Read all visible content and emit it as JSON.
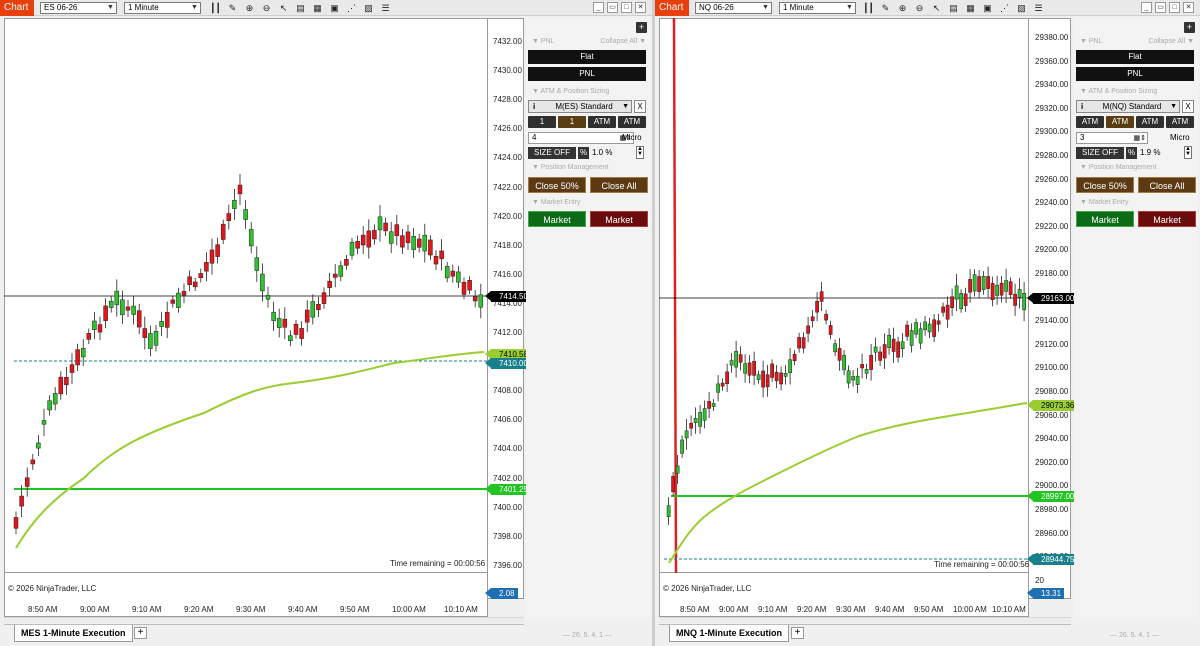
{
  "left": {
    "chart_button": "Chart",
    "instrument": "ES 06-26",
    "interval": "1 Minute",
    "copyright": "© 2026 NinjaTrader, LLC",
    "time_remaining": "Time remaining = 00:00:56",
    "tab_label": "MES 1-Minute Execution",
    "version": "— 26. 5. 4. 1 —",
    "price_labels": {
      "last": "7414.50",
      "vwap": "7410.58",
      "line_teal": "7410.00",
      "line_green": "7401.25",
      "bottom": "2.08"
    },
    "colors": {
      "last": "#000000",
      "vwap": "#9acd32",
      "teal": "#17808a",
      "green": "#22c422",
      "bottom": "#1f6fb3"
    },
    "y_ticks": [
      "7432.00",
      "7430.00",
      "7428.00",
      "7426.00",
      "7424.00",
      "7422.00",
      "7420.00",
      "7418.00",
      "7416.00",
      "7414.00",
      "7412.00",
      "7410.00",
      "7408.00",
      "7406.00",
      "7404.00",
      "7402.00",
      "7400.00",
      "7398.00",
      "7396.00"
    ],
    "x_ticks": [
      "8:50 AM",
      "9:00 AM",
      "9:10 AM",
      "9:20 AM",
      "9:30 AM",
      "9:40 AM",
      "9:50 AM",
      "10:00 AM",
      "10:10 AM"
    ],
    "panel": {
      "pnl_header": "▼ PNL",
      "collapse": "Collapse All ▼",
      "flat": "Flat",
      "pnl": "PNL",
      "atm_header": "▼ ATM & Position Sizing",
      "atm_template": "M(ES) Standard",
      "close_x": "X",
      "qty_buttons": [
        "1",
        "1",
        "ATM",
        "ATM"
      ],
      "qty_value": "4",
      "micro": "Micro",
      "size_off": "SIZE OFF",
      "pct_btn": "%",
      "pct_value": "1.0 %",
      "pos_header": "▼ Position Management",
      "close50": "Close 50%",
      "close_all": "Close All",
      "entry_header": "▼ Market Entry",
      "market_buy": "Market",
      "market_sell": "Market"
    }
  },
  "right": {
    "chart_button": "Chart",
    "instrument": "NQ 06-26",
    "interval": "1 Minute",
    "copyright": "© 2026 NinjaTrader, LLC",
    "time_remaining": "Time remaining = 00:00:56",
    "tab_label": "MNQ 1-Minute Execution",
    "version": "— 26. 5. 4. 1 —",
    "price_labels": {
      "last": "29163.00",
      "vwap": "29073.36",
      "line_green": "28997.00",
      "line_teal": "28944.75",
      "bottom": "13.31"
    },
    "colors": {
      "last": "#000000",
      "vwap": "#9acd32",
      "teal": "#17808a",
      "green": "#22c422",
      "bottom": "#1f6fb3"
    },
    "y_ticks": [
      "29380.00",
      "29360.00",
      "29340.00",
      "29320.00",
      "29300.00",
      "29280.00",
      "29260.00",
      "29240.00",
      "29220.00",
      "29200.00",
      "29180.00",
      "29160.00",
      "29140.00",
      "29120.00",
      "29100.00",
      "29080.00",
      "29060.00",
      "29040.00",
      "29020.00",
      "29000.00",
      "28980.00",
      "28960.00",
      "28940.00",
      "20"
    ],
    "x_ticks": [
      "8:50 AM",
      "9:00 AM",
      "9:10 AM",
      "9:20 AM",
      "9:30 AM",
      "9:40 AM",
      "9:50 AM",
      "10:00 AM",
      "10:10 AM"
    ],
    "panel": {
      "pnl_header": "▼ PNL",
      "collapse": "Collapse All ▼",
      "flat": "Flat",
      "pnl": "PNL",
      "atm_header": "▼ ATM & Position Sizing",
      "atm_template": "M(NQ) Standard",
      "close_x": "X",
      "qty_buttons": [
        "ATM",
        "ATM",
        "ATM",
        "ATM"
      ],
      "qty_value": "3",
      "micro": "Micro",
      "size_off": "SIZE OFF",
      "pct_btn": "%",
      "pct_value": "1.9 %",
      "pos_header": "▼ Position Management",
      "close50": "Close 50%",
      "close_all": "Close All",
      "entry_header": "▼ Market Entry",
      "market_buy": "Market",
      "market_sell": "Market"
    }
  },
  "toolbar_icons": [
    "bar-type-icon",
    "draw-icon",
    "zoom-in-icon",
    "zoom-out-icon",
    "cursor-icon",
    "data-box-icon",
    "chart-trader-icon",
    "strategies-icon",
    "indicators-icon",
    "properties-icon"
  ]
}
